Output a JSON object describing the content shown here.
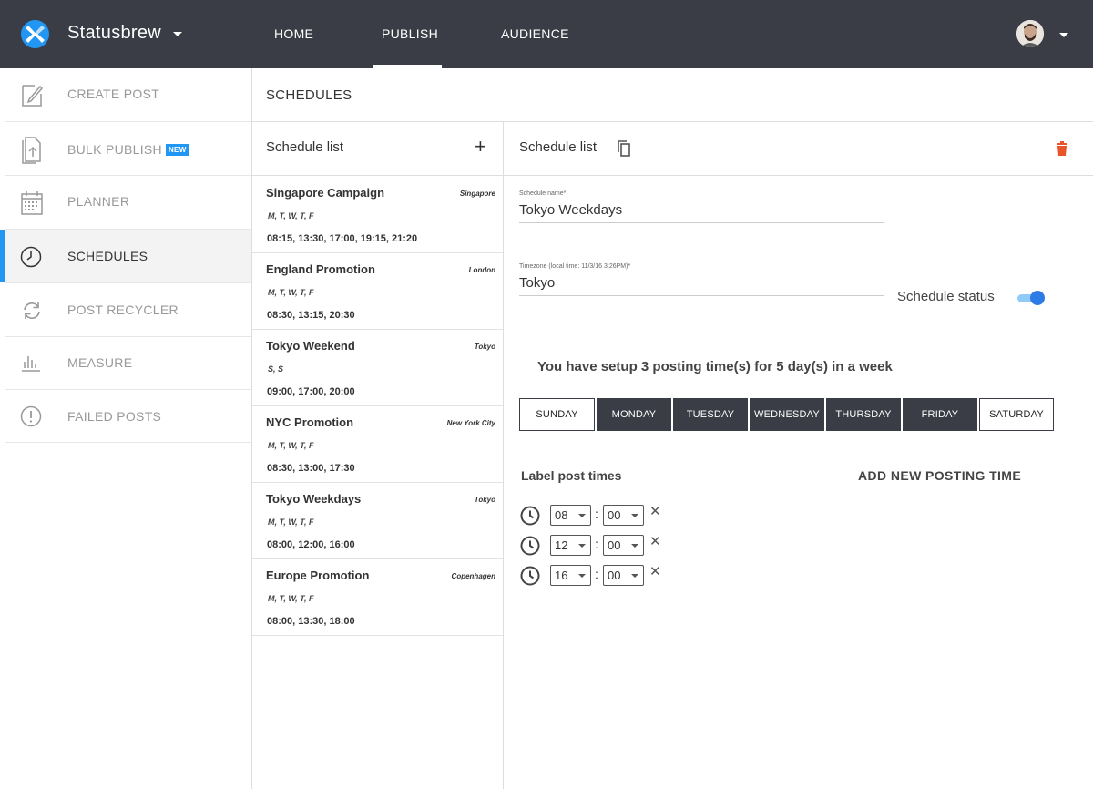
{
  "app": {
    "brand": "Statusbrew",
    "nav": [
      {
        "label": "HOME"
      },
      {
        "label": "PUBLISH"
      },
      {
        "label": "AUDIENCE"
      }
    ]
  },
  "sidebar": {
    "items": [
      {
        "label": "CREATE POST",
        "icon": "edit-icon"
      },
      {
        "label": "BULK PUBLISH",
        "icon": "bulk-upload-icon",
        "badge": "NEW"
      },
      {
        "label": "PLANNER",
        "icon": "calendar-icon"
      },
      {
        "label": "SCHEDULES",
        "icon": "clock-icon"
      },
      {
        "label": "POST RECYCLER",
        "icon": "recycle-icon"
      },
      {
        "label": "MEASURE",
        "icon": "bar-chart-icon"
      },
      {
        "label": "FAILED POSTS",
        "icon": "alert-icon"
      }
    ]
  },
  "page": {
    "title": "SCHEDULES"
  },
  "schedule_list": {
    "title": "Schedule list",
    "add_label": "+",
    "items": [
      {
        "name": "Singapore Campaign",
        "tz": "Singapore",
        "days": "M, T, W, T, F",
        "times": "08:15, 13:30, 17:00, 19:15, 21:20"
      },
      {
        "name": "England Promotion",
        "tz": "London",
        "days": "M, T, W, T, F",
        "times": "08:30, 13:15, 20:30"
      },
      {
        "name": "Tokyo Weekend",
        "tz": "Tokyo",
        "days": "S, S",
        "times": "09:00, 17:00, 20:00"
      },
      {
        "name": "NYC Promotion",
        "tz": "New York City",
        "days": "M, T, W, T, F",
        "times": "08:30, 13:00, 17:30"
      },
      {
        "name": "Tokyo Weekdays",
        "tz": "Tokyo",
        "days": "M, T, W, T, F",
        "times": "08:00, 12:00, 16:00"
      },
      {
        "name": "Europe Promotion",
        "tz": "Copenhagen",
        "days": "M, T, W, T, F",
        "times": "08:00, 13:30, 18:00"
      }
    ]
  },
  "detail": {
    "title": "Schedule list",
    "name_label": "Schedule name*",
    "name_value": "Tokyo Weekdays",
    "tz_label": "Timezone (local time: 11/3/16 3:26PM)*",
    "tz_value": "Tokyo",
    "status_label": "Schedule status",
    "status_on": true,
    "summary": "You have setup 3 posting time(s) for 5 day(s) in a week",
    "days": [
      {
        "label": "SUNDAY",
        "selected": false
      },
      {
        "label": "MONDAY",
        "selected": true
      },
      {
        "label": "TUESDAY",
        "selected": true
      },
      {
        "label": "WEDNESDAY",
        "selected": true
      },
      {
        "label": "THURSDAY",
        "selected": true
      },
      {
        "label": "FRIDAY",
        "selected": true
      },
      {
        "label": "SATURDAY",
        "selected": false
      }
    ],
    "label_post_times": "Label post times",
    "add_time": "ADD NEW POSTING TIME",
    "colon": ":",
    "remove_glyph": "✕",
    "times": [
      {
        "hour": "08",
        "minute": "00"
      },
      {
        "hour": "12",
        "minute": "00"
      },
      {
        "hour": "16",
        "minute": "00"
      }
    ]
  },
  "colors": {
    "accent": "#2196f3",
    "topbar": "#3a3d45",
    "delete": "#e8552b"
  }
}
